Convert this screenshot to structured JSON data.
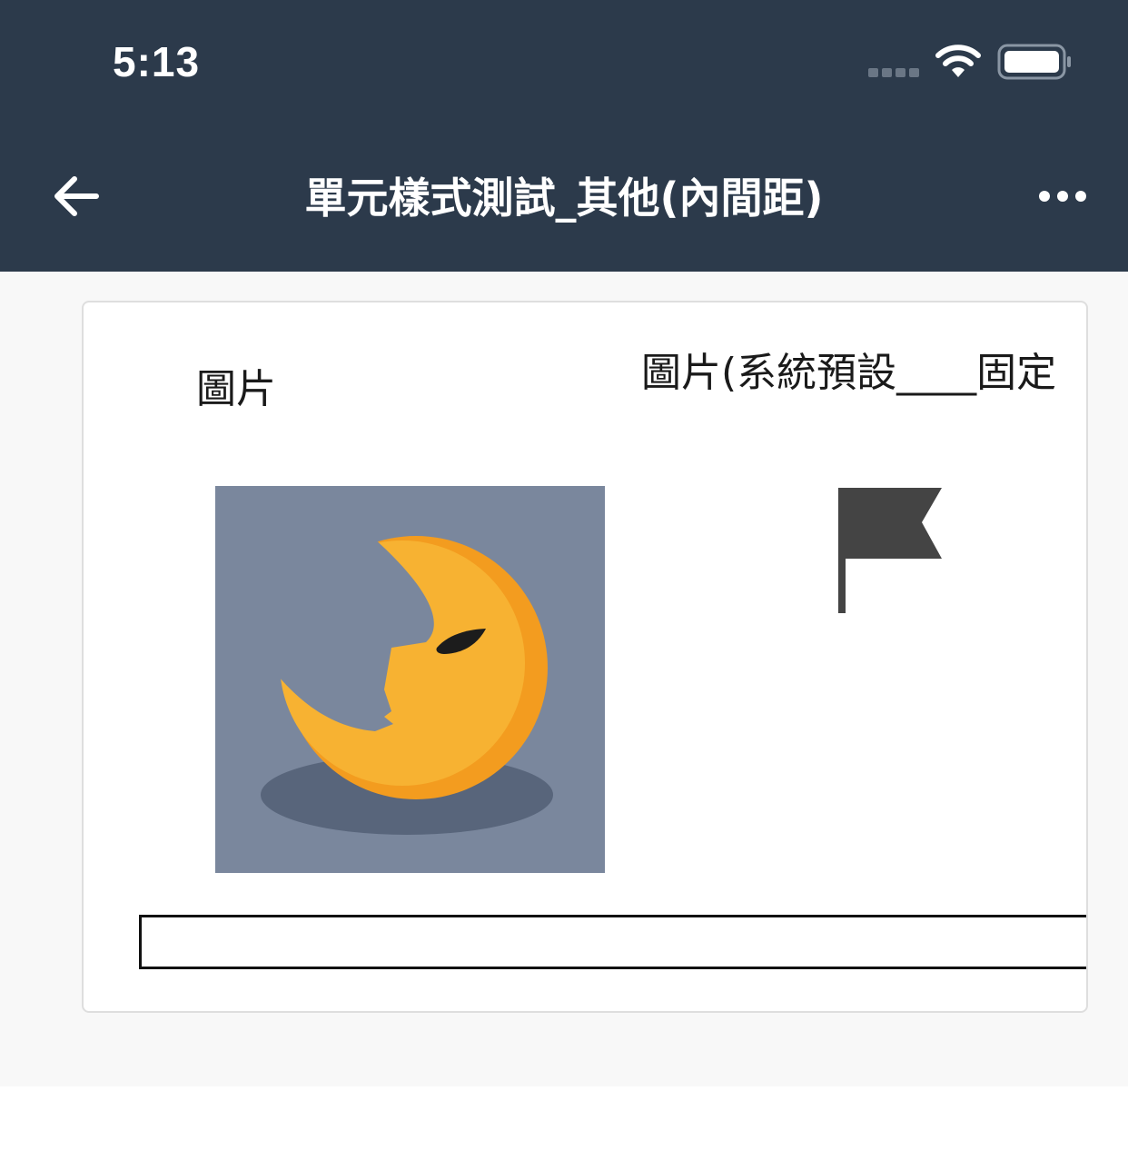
{
  "status_bar": {
    "time": "5:13"
  },
  "nav": {
    "back_icon": "arrow-left-icon",
    "title": "單元樣式測試_其他(內間距)",
    "more_icon": "more-horizontal-icon"
  },
  "card": {
    "image_label_1": "圖片",
    "image_label_2": "圖片(系統預設____固定",
    "image_1_icon": "crescent-moon-image",
    "image_2_icon": "flag-icon"
  },
  "colors": {
    "header_bg": "#2c3a4b",
    "moon_bg": "#7a879d",
    "moon": "#f5a623",
    "flag": "#444444"
  }
}
